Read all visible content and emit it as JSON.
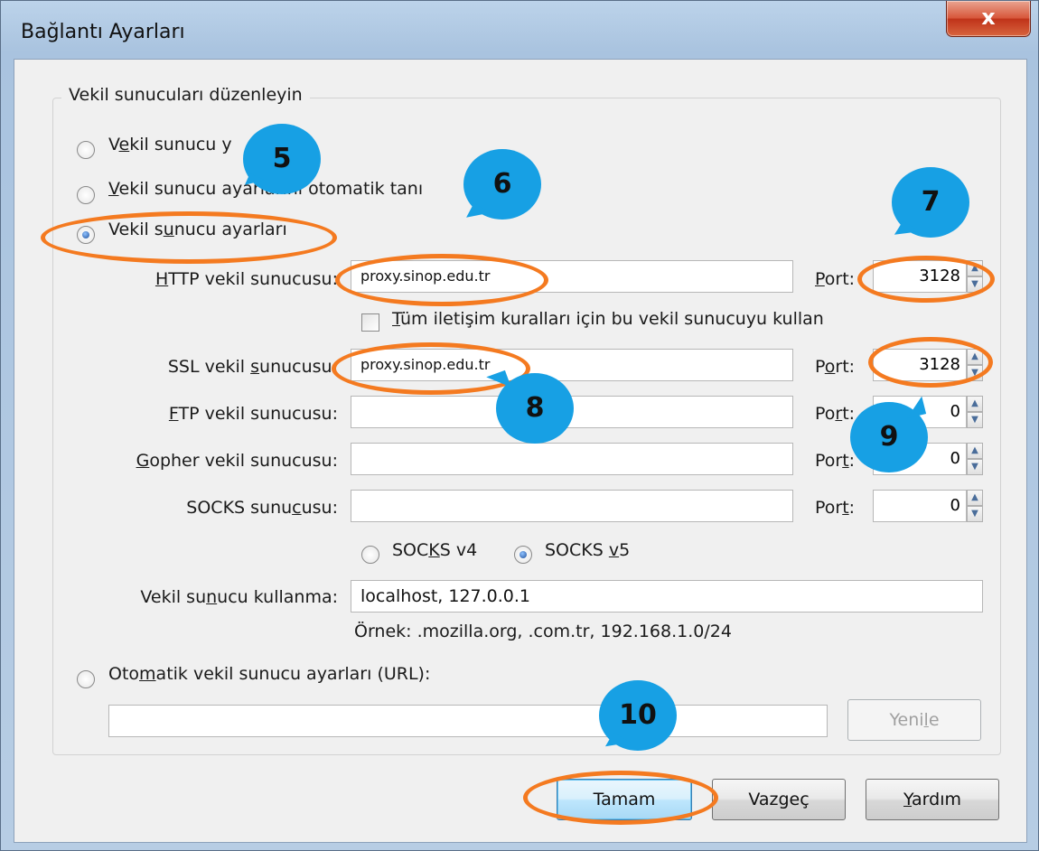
{
  "window": {
    "title": "Bağlantı Ayarları",
    "close_glyph": "x"
  },
  "group": {
    "legend": "Vekil sunucuları düzenleyin"
  },
  "radios": {
    "no_proxy": {
      "pre": "V",
      "ul": "e",
      "post": "kil sunucu y",
      "selected": false
    },
    "auto_detect": {
      "pre": "",
      "ul": "V",
      "post": "ekil sunucu ayarlarını otomatik tanı",
      "selected": false
    },
    "manual": {
      "pre": "Vekil s",
      "ul": "u",
      "post": "nucu ayarları",
      "selected": true
    },
    "auto_url": {
      "pre": "Oto",
      "ul": "m",
      "post": "atik vekil sunucu ayarları (URL):",
      "selected": false
    }
  },
  "fields": {
    "http": {
      "label_ul": "H",
      "label_rest": "TTP vekil sunucusu:",
      "value": "proxy.sinop.edu.tr",
      "port_label_ul": "P",
      "port_label_rest": "ort:",
      "port": "3128"
    },
    "share_all": {
      "ul": "T",
      "rest": "üm iletişim kuralları için bu vekil sunucuyu kullan",
      "checked": false
    },
    "ssl": {
      "label_pre": "SSL vekil ",
      "label_ul": "s",
      "label_rest": "unucusu:",
      "value": "proxy.sinop.edu.tr",
      "port_label_pre": "P",
      "port_label_ul": "o",
      "port_label_rest": "rt:",
      "port": "3128"
    },
    "ftp": {
      "label_ul": "F",
      "label_rest": "TP vekil sunucusu:",
      "value": "",
      "port_label_pre": "Po",
      "port_label_ul": "r",
      "port_label_rest": "t:",
      "port": "0"
    },
    "gopher": {
      "label_ul": "G",
      "label_rest": "opher vekil sunucusu:",
      "value": "",
      "port_label_pre": "Por",
      "port_label_ul": "t",
      "port_label_rest": ":",
      "port": "0"
    },
    "socks": {
      "label_pre": "SOCKS sunu",
      "label_ul": "c",
      "label_rest": "usu:",
      "value": "",
      "port_label_pre": "Por",
      "port_label_ul": "t",
      "port_label_rest": ":",
      "port": "0"
    }
  },
  "socks_version": {
    "v4": {
      "pre": "SOC",
      "ul": "K",
      "post": "S v4",
      "selected": false
    },
    "v5": {
      "pre": "SOCKS ",
      "ul": "v",
      "post": "5",
      "selected": true
    }
  },
  "no_proxy": {
    "label_pre": "Vekil su",
    "label_ul": "n",
    "label_rest": "ucu kullanma:",
    "value": "localhost, 127.0.0.1",
    "example": "Örnek: .mozilla.org, .com.tr, 192.168.1.0/24"
  },
  "auto_url": {
    "value": "",
    "reload_pre": "Yeni",
    "reload_ul": "l",
    "reload_post": "e"
  },
  "buttons": {
    "ok": "Tamam",
    "cancel": "Vazgeç",
    "help_ul": "Y",
    "help_rest": "ardım"
  },
  "annotations": {
    "accent": "#f47a20",
    "bubble_color": "#17a0e4",
    "numbers": [
      "5",
      "6",
      "7",
      "8",
      "9",
      "10"
    ]
  }
}
